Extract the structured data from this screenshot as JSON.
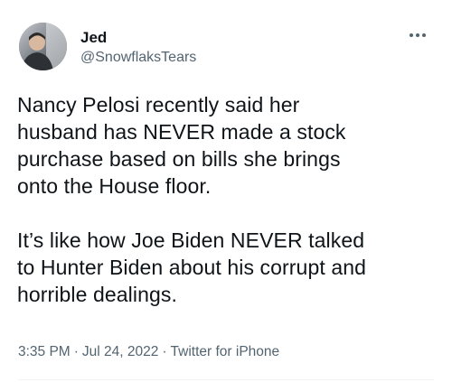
{
  "author": {
    "display_name": "Jed",
    "handle": "@SnowflaksTears"
  },
  "tweet": {
    "paragraphs": [
      [
        "Nancy Pelosi recently said her",
        "husband has NEVER made a stock",
        "purchase based on bills she brings",
        "onto the House floor."
      ],
      [
        "It’s like how Joe Biden NEVER talked",
        "to Hunter Biden about his corrupt and",
        "horrible dealings."
      ]
    ],
    "time": "3:35 PM",
    "date": "Jul 24, 2022",
    "source": "Twitter for iPhone",
    "separator": "·"
  },
  "icons": {
    "more": "more-options-icon",
    "avatar": "profile-avatar"
  },
  "colors": {
    "text_primary": "#0f1419",
    "text_secondary": "#536471"
  }
}
